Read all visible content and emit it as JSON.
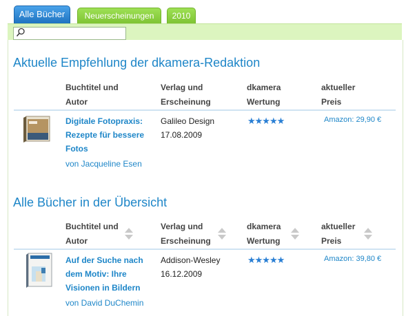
{
  "tabs": [
    {
      "label": "Alle Bücher",
      "active": true
    },
    {
      "label": "Neuerscheinungen",
      "active": false
    },
    {
      "label": "2010",
      "active": false
    }
  ],
  "search": {
    "placeholder": "",
    "value": ""
  },
  "recommendation": {
    "heading": "Aktuelle Empfehlung der dkamera-Redaktion",
    "columns": {
      "title": [
        "Buchtitel und",
        "Autor"
      ],
      "publisher": [
        "Verlag und",
        "Erscheinung"
      ],
      "rating": [
        "dkamera",
        "Wertung"
      ],
      "price": [
        "aktueller",
        "Preis"
      ]
    },
    "book": {
      "title_lines": [
        "Digitale Fotopraxis:",
        "Rezepte für bessere",
        "Fotos"
      ],
      "author": "von Jacqueline Esen",
      "publisher": "Galileo Design",
      "date": "17.08.2009",
      "stars": "★★★★★",
      "rating": 5,
      "price": "Amazon: 29,90 €"
    }
  },
  "overview": {
    "heading": "Alle Bücher in der Übersicht",
    "columns": {
      "title": [
        "Buchtitel und",
        "Autor"
      ],
      "publisher": [
        "Verlag und",
        "Erscheinung"
      ],
      "rating": [
        "dkamera",
        "Wertung"
      ],
      "price": [
        "aktueller",
        "Preis"
      ]
    },
    "books": [
      {
        "title_lines": [
          "Auf der Suche nach",
          "dem Motiv: Ihre",
          "Visionen in Bildern"
        ],
        "author": "von David DuChemin",
        "publisher": "Addison-Wesley",
        "date": "16.12.2009",
        "stars": "★★★★★",
        "rating": 5,
        "price": "Amazon: 39,80 €"
      }
    ]
  },
  "colors": {
    "accent": "#1e86c8",
    "tab_active": "#2f87d0",
    "tab_inactive": "#8bd13f",
    "searchbar": "#dcf5bf"
  }
}
